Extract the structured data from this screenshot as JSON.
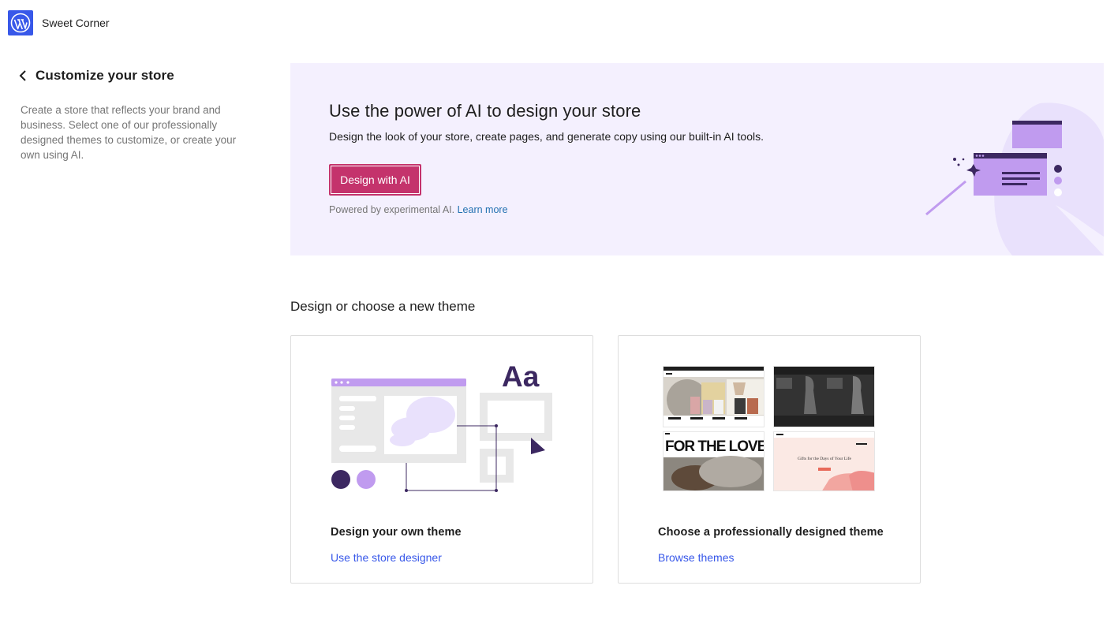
{
  "header": {
    "site_name": "Sweet Corner",
    "logo_icon": "wordpress-logo-icon",
    "logo_color": "#3858e9"
  },
  "sidebar": {
    "back_icon": "chevron-left-icon",
    "title": "Customize your store",
    "description": "Create a store that reflects your brand and business. Select one of our professionally designed themes to customize, or create your own using AI."
  },
  "ai_banner": {
    "title": "Use the power of AI to design your store",
    "description": "Design the look of your store, create pages, and generate copy using our built-in AI tools.",
    "button_label": "Design with AI",
    "powered_text": "Powered by experimental AI.",
    "learn_more": "Learn more",
    "background": "#f4f0fe",
    "button_color": "#c4336c"
  },
  "section": {
    "title": "Design or choose a new theme"
  },
  "cards": {
    "own": {
      "title": "Design your own theme",
      "link": "Use the store designer",
      "illus_text": "Aa"
    },
    "pro": {
      "title": "Choose a professionally designed theme",
      "link": "Browse themes",
      "thumb_headline": "FOR THE LOVE OF B",
      "thumb_tagline": "Gifts for the Days of Your Life"
    }
  },
  "colors": {
    "accent": "#3858e9",
    "purple": "#c09bef",
    "dark_purple": "#3c2861"
  }
}
